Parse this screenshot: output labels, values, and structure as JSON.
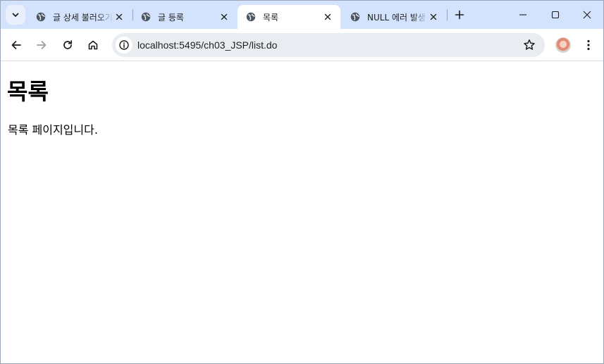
{
  "browser": {
    "tabs": [
      {
        "title": "글 상세 불러오기",
        "active": false
      },
      {
        "title": "글 등록",
        "active": false
      },
      {
        "title": "목록",
        "active": true
      },
      {
        "title": "NULL 에러 발생",
        "active": false
      }
    ],
    "address_bar": {
      "url": "localhost:5495/ch03_JSP/list.do"
    },
    "accent_color": "#d3e3fd"
  },
  "page": {
    "heading": "목록",
    "body_text": "목록 페이지입니다."
  }
}
